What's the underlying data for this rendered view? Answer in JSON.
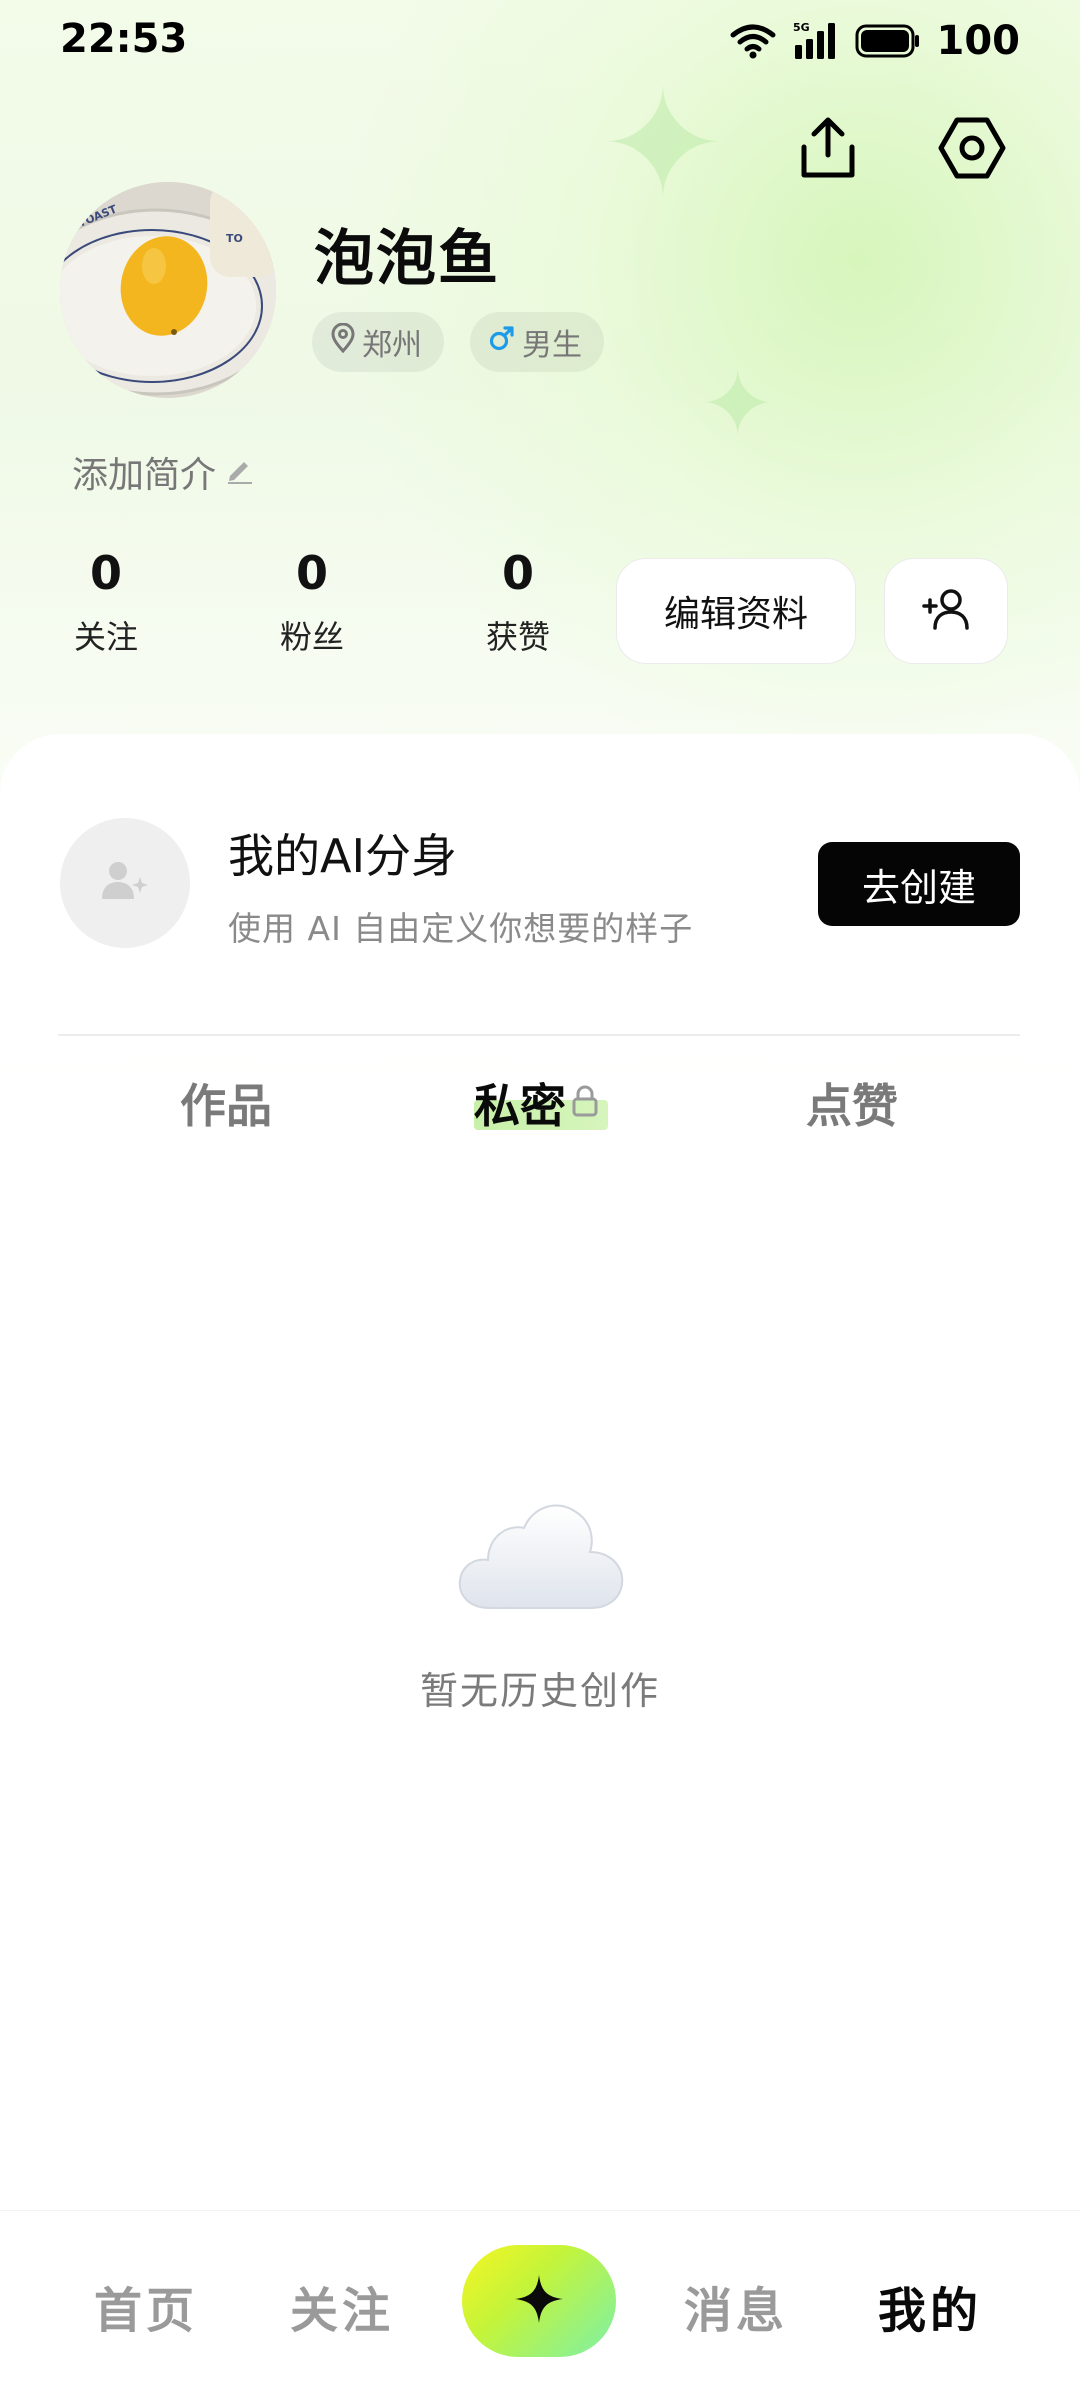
{
  "status_bar": {
    "time": "22:53",
    "battery_percent": "100",
    "icons": [
      "wifi-icon",
      "signal-5g-icon",
      "battery-icon"
    ]
  },
  "header_actions": {
    "share_icon": "share-icon",
    "settings_icon": "settings-icon"
  },
  "profile": {
    "username": "泡泡鱼",
    "location": "郑州",
    "gender": "男生",
    "bio_placeholder": "添加简介",
    "stats": [
      {
        "value": "0",
        "label": "关注"
      },
      {
        "value": "0",
        "label": "粉丝"
      },
      {
        "value": "0",
        "label": "获赞"
      }
    ],
    "edit_button_label": "编辑资料",
    "gender_color": "#1e9be8"
  },
  "ai_clone": {
    "title": "我的AI分身",
    "subtitle": "使用 AI 自由定义你想要的样子",
    "create_label": "去创建"
  },
  "tabs": [
    {
      "label": "作品",
      "active": false
    },
    {
      "label": "私密",
      "active": true
    },
    {
      "label": "点赞",
      "active": false
    }
  ],
  "empty_state": {
    "message": "暂无历史创作"
  },
  "bottom_nav": {
    "items": [
      {
        "label": "首页",
        "active": false
      },
      {
        "label": "关注",
        "active": false
      },
      {
        "label": "消息",
        "active": false
      },
      {
        "label": "我的",
        "active": true
      }
    ],
    "center_icon": "sparkle-icon",
    "accent_gradient": [
      "#f6f622",
      "#c4f43a",
      "#7cf0a8"
    ]
  }
}
